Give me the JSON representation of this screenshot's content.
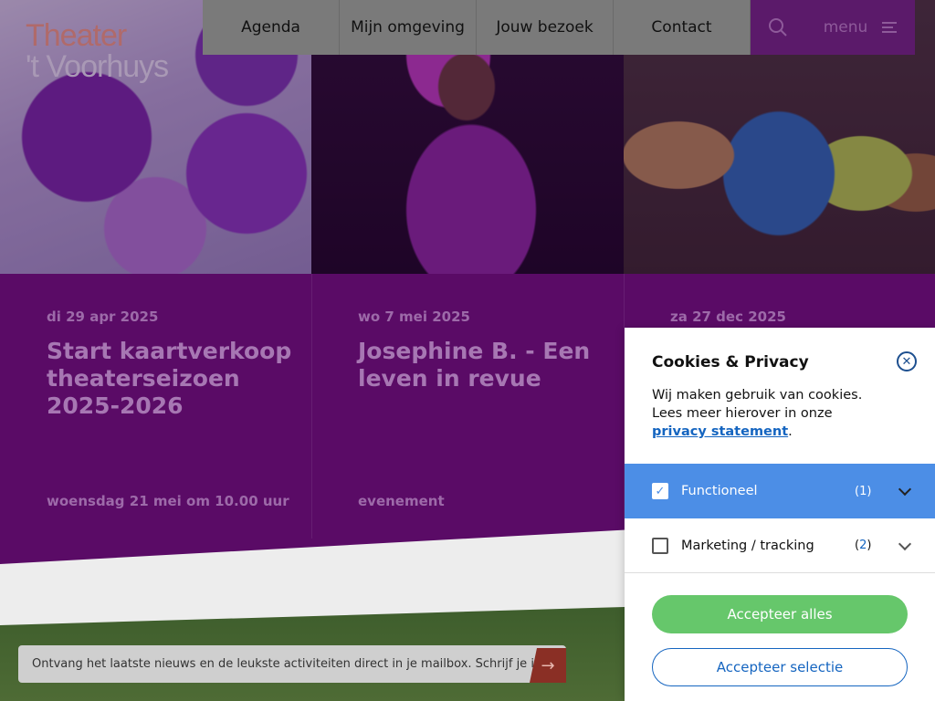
{
  "logo": {
    "line1": "Theater",
    "line2": "'t Voorhuys"
  },
  "nav": {
    "items": [
      "Agenda",
      "Mijn omgeving",
      "Jouw bezoek",
      "Contact"
    ],
    "menu_label": "menu"
  },
  "cards": [
    {
      "date": "di 29 apr 2025",
      "title": "Start kaartverkoop theaterseizoen 2025-2026",
      "footer": "woensdag 21 mei om 10.00 uur"
    },
    {
      "date": "wo 7 mei 2025",
      "title": "Josephine B. - Een leven in revue",
      "footer": "evenement"
    },
    {
      "date": "za 27 dec 2025",
      "title": "",
      "footer": ""
    }
  ],
  "newsletter": {
    "text": "Ontvang het laatste nieuws en de leukste activiteiten direct in je mailbox. Schrijf je in:"
  },
  "cookie": {
    "title": "Cookies & Privacy",
    "text_line1": "Wij maken gebruik van cookies.",
    "text_line2": "Lees meer hierover in onze",
    "link": "privacy statement",
    "link_suffix": ".",
    "rows": [
      {
        "label": "Functioneel",
        "count": "1",
        "checked": true
      },
      {
        "label": "Marketing / tracking",
        "count": "2",
        "checked": false
      }
    ],
    "accept_all": "Accepteer alles",
    "accept_selection": "Accepteer selectie"
  },
  "colors": {
    "purple": "#5a0b66",
    "accent_blue": "#4c8ee6",
    "green": "#66c76b",
    "link_blue": "#1565c0"
  }
}
